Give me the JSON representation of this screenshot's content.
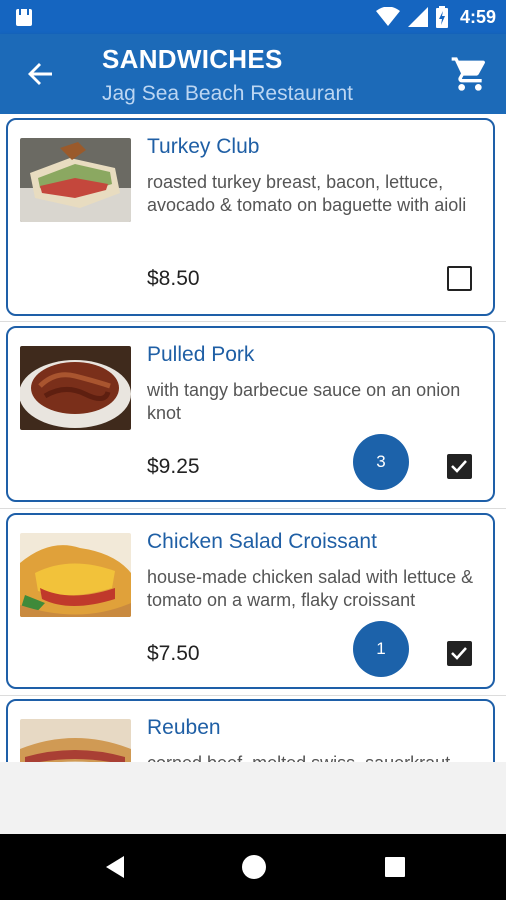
{
  "status": {
    "time": "4:59"
  },
  "header": {
    "title": "SANDWICHES",
    "subtitle": "Jag Sea Beach Restaurant"
  },
  "items": [
    {
      "name": "Turkey Club",
      "description": "roasted turkey breast, bacon, lettuce, avocado & tomato on baguette with aioli",
      "price": "$8.50",
      "quantity": null,
      "checked": false
    },
    {
      "name": "Pulled Pork",
      "description": "with tangy barbecue sauce on an onion knot",
      "price": "$9.25",
      "quantity": "3",
      "checked": true
    },
    {
      "name": "Chicken Salad Croissant",
      "description": "house-made chicken salad with lettuce & tomato on a warm, flaky croissant",
      "price": "$7.50",
      "quantity": "1",
      "checked": true
    },
    {
      "name": "Reuben",
      "description": "corned beef, melted swiss, sauerkraut",
      "price": "",
      "quantity": null,
      "checked": false
    }
  ],
  "colors": {
    "primary": "#1c6ab8",
    "status_bar": "#1565c0",
    "accent_text": "#1f5fa5",
    "card_border": "#1e5fa8"
  },
  "icons": {
    "back": "arrow-back-icon",
    "cart": "shopping-cart-icon",
    "nav_back": "triangle-back-icon",
    "nav_home": "circle-home-icon",
    "nav_recents": "square-recents-icon"
  }
}
